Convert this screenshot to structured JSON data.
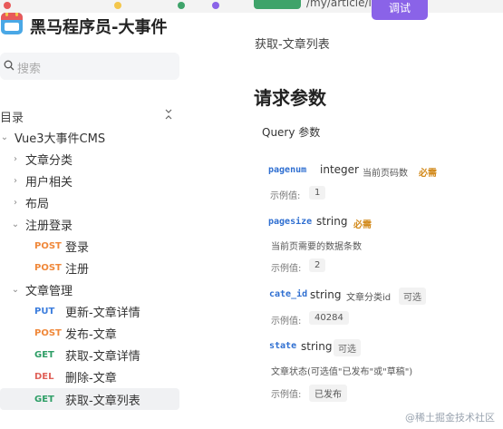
{
  "sidebar": {
    "brand_title": "黑马程序员-大事件",
    "search_placeholder": "搜索",
    "toc_label": "目录",
    "project": "Vue3大事件CMS",
    "groups": {
      "article_category": "文章分类",
      "user": "用户相关",
      "layout": "布局",
      "auth": "注册登录",
      "article_manage": "文章管理"
    },
    "auth_items": [
      {
        "method": "POST",
        "label": "登录"
      },
      {
        "method": "POST",
        "label": "注册"
      }
    ],
    "article_items": [
      {
        "method": "PUT",
        "label": "更新-文章详情"
      },
      {
        "method": "POST",
        "label": "发布-文章"
      },
      {
        "method": "GET",
        "label": "获取-文章详情"
      },
      {
        "method": "DEL",
        "label": "删除-文章"
      },
      {
        "method": "GET",
        "label": "获取-文章列表"
      }
    ]
  },
  "header": {
    "path": "/my/article/list",
    "try_label": "调试",
    "page_subtitle": "获取-文章列表"
  },
  "params": {
    "section_title": "请求参数",
    "query_title": "Query 参数",
    "example_label": "示例值:",
    "required_label": "必需",
    "optional_label": "可选",
    "items": [
      {
        "name": "pagenum",
        "type": "integer",
        "desc": "当前页码数",
        "example": "1"
      },
      {
        "name": "pagesize",
        "type": "string",
        "desc": "当前页需要的数据条数",
        "example": "2"
      },
      {
        "name": "cate_id",
        "type": "string",
        "desc": "文章分类id",
        "example": "40284"
      },
      {
        "name": "state",
        "type": "string",
        "desc": "文章状态(可选值\"已发布\"或\"草稿\")",
        "example": "已发布"
      }
    ]
  },
  "watermark": "@稀土掘金技术社区",
  "colors": {
    "post": "#f0883a",
    "put": "#3b7ddd",
    "get": "#2e9e66",
    "del": "#e0625a",
    "param_name": "#2f6fd1",
    "required": "#d28a1c",
    "try_button": "#8a63e8"
  }
}
